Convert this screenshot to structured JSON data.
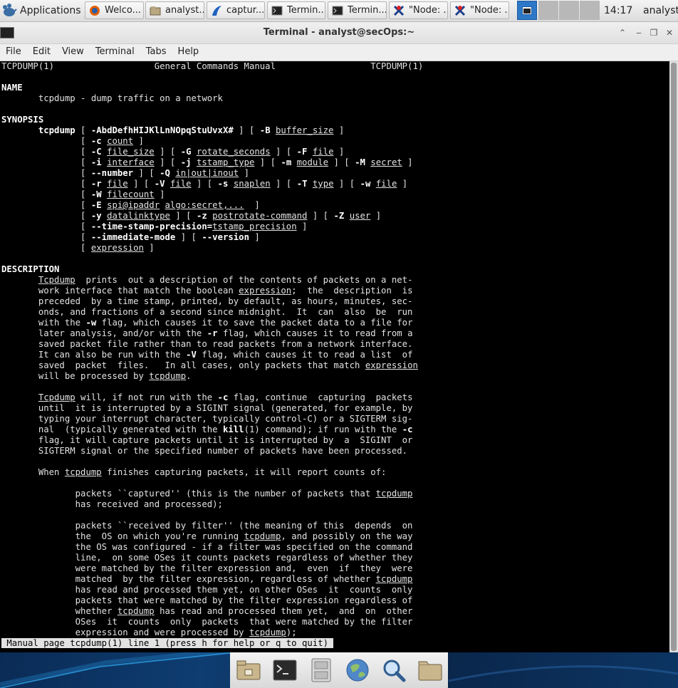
{
  "panel": {
    "applications_label": "Applications",
    "tasks": [
      {
        "label": "Welco...",
        "icon": "firefox-icon"
      },
      {
        "label": "analyst...",
        "icon": "file-manager-icon"
      },
      {
        "label": "captur...",
        "icon": "wireshark-icon"
      },
      {
        "label": "Termin...",
        "icon": "terminal-icon"
      },
      {
        "label": "Termin...",
        "icon": "terminal-icon"
      },
      {
        "label": "\"Node: ...",
        "icon": "mininet-icon"
      },
      {
        "label": "\"Node: ...",
        "icon": "mininet-icon"
      }
    ],
    "clock": "14:17",
    "user": "analyst"
  },
  "window": {
    "title": "Terminal - analyst@secOps:~"
  },
  "menu": [
    "File",
    "Edit",
    "View",
    "Terminal",
    "Tabs",
    "Help"
  ],
  "colors": {
    "terminal_bg": "#000000",
    "terminal_fg": "#e2e2e2",
    "active_task": "#2e78c8"
  },
  "terminal": {
    "lines": [
      "TCPDUMP(1)                   General Commands Manual                  TCPDUMP(1)",
      "",
      "**NAME**",
      "       tcpdump - dump traffic on a network",
      "",
      "**SYNOPSIS**",
      "       **tcpdump** [ **-AbdDefhHIJKlLnNOpqStuUvxX#** ] [ **-B** __buffer_size__ ]",
      "               [ **-c** __count__ ]",
      "               [ **-C** __file_size__ ] [ **-G** __rotate_seconds__ ] [ **-F** __file__ ]",
      "               [ **-i** __interface__ ] [ **-j** __tstamp_type__ ] [ **-m** __module__ ] [ **-M** __secret__ ]",
      "               [ **--number** ] [ **-Q** __in|out|inout__ ]",
      "               [ **-r** __file__ ] [ **-V** __file__ ] [ **-s** __snaplen__ ] [ **-T** __type__ ] [ **-w** __file__ ]",
      "               [ **-W** __filecount__ ]",
      "               [ **-E** __spi@ipaddr__ __algo:secret,...__  ]",
      "               [ **-y** __datalinktype__ ] [ **-z** __postrotate-command__ ] [ **-Z** __user__ ]",
      "               [ **--time-stamp-precision=**__tstamp_precision__ ]",
      "               [ **--immediate-mode** ] [ **--version** ]",
      "               [ __expression__ ]",
      "",
      "**DESCRIPTION**",
      "       __Tcpdump__  prints  out a description of the contents of packets on a net-",
      "       work interface that match the boolean __expression__;  the  description  is",
      "       preceded  by a time stamp, printed, by default, as hours, minutes, sec-",
      "       onds, and fractions of a second since midnight.  It  can  also  be  run",
      "       with the **-w** flag, which causes it to save the packet data to a file for",
      "       later analysis, and/or with the **-r** flag, which causes it to read from a",
      "       saved packet file rather than to read packets from a network interface.",
      "       It can also be run with the **-V** flag, which causes it to read a list  of",
      "       saved  packet  files.   In all cases, only packets that match __expression__",
      "       will be processed by __tcpdump__.",
      "",
      "       __Tcpdump__ will, if not run with the **-c** flag, continue  capturing  packets",
      "       until  it is interrupted by a SIGINT signal (generated, for example, by",
      "       typing your interrupt character, typically control-C) or a SIGTERM sig-",
      "       nal  (typically generated with the **kill**(1) command); if run with the **-c**",
      "       flag, it will capture packets until it is interrupted by  a  SIGINT  or",
      "       SIGTERM signal or the specified number of packets have been processed.",
      "",
      "       When __tcpdump__ finishes capturing packets, it will report counts of:",
      "",
      "              packets ``captured'' (this is the number of packets that __tcpdump__",
      "              has received and processed);",
      "",
      "              packets ``received by filter'' (the meaning of this  depends  on",
      "              the  OS on which you're running __tcpdump__, and possibly on the way",
      "              the OS was configured - if a filter was specified on the command",
      "              line,  on some OSes it counts packets regardless of whether they",
      "              were matched by the filter expression and,  even  if  they  were",
      "              matched  by the filter expression, regardless of whether __tcpdump__",
      "              has read and processed them yet, on other OSes  it  counts  only",
      "              packets that were matched by the filter expression regardless of",
      "              whether __tcpdump__ has read and processed them yet,  and  on  other",
      "              OSes  it  counts  only  packets  that were matched by the filter",
      "              expression and were processed by __tcpdump__);"
    ],
    "status_line": " Manual page tcpdump(1) line 1 (press h for help or q to quit) "
  }
}
